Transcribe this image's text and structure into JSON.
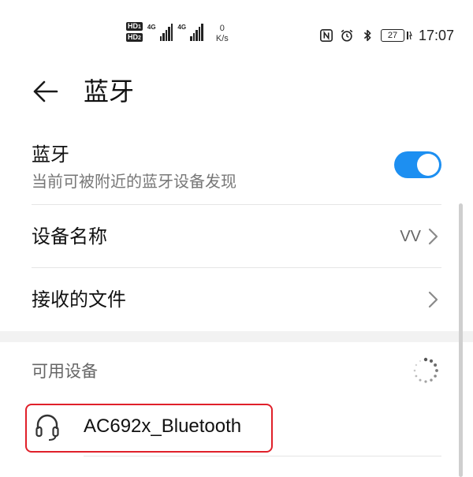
{
  "status_bar": {
    "hd1": "HD",
    "hd1_sub": "1",
    "hd2": "HD",
    "hd2_sub": "2",
    "sim1_net": "4G",
    "sim2_net": "4G",
    "speed_value": "0",
    "speed_unit": "K/s",
    "battery": "27",
    "time": "17:07",
    "icons": [
      "nfc-icon",
      "alarm-icon",
      "bluetooth-icon",
      "battery-icon",
      "charging-icon"
    ]
  },
  "header": {
    "title": "蓝牙",
    "back_icon": "arrow-left-icon"
  },
  "bluetooth": {
    "title": "蓝牙",
    "subtitle": "当前可被附近的蓝牙设备发现",
    "enabled": true,
    "accent_color": "#1d8ff1"
  },
  "device_name_row": {
    "label": "设备名称",
    "value": "VV"
  },
  "received_files_row": {
    "label": "接收的文件"
  },
  "available_devices": {
    "label": "可用设备",
    "items": [
      {
        "name": "AC692x_Bluetooth",
        "icon": "headset-icon"
      }
    ]
  }
}
